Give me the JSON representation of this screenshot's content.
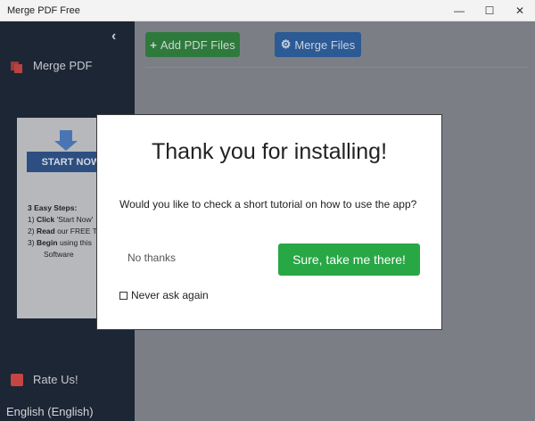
{
  "window": {
    "title": "Merge PDF Free",
    "minimize_glyph": "—",
    "maximize_glyph": "☐",
    "close_glyph": "✕"
  },
  "sidebar": {
    "collapse_glyph": "‹",
    "items": [
      {
        "label": "Merge PDF",
        "icon": "pdf-icon"
      },
      {
        "label": "Rate Us!",
        "icon": "rate-icon"
      }
    ],
    "language": "English (English)"
  },
  "ad": {
    "start_label": "START NOW",
    "steps_title": "3 Easy Steps:",
    "step1_num": "1)",
    "step1_bold": "Click",
    "step1_text": "'Start Now'",
    "step2_num": "2)",
    "step2_bold": "Read",
    "step2_text": "our FREE Tu",
    "step3_num": "3)",
    "step3_bold": "Begin",
    "step3_text": "using this",
    "step3_line2": "Software"
  },
  "toolbar": {
    "add_label": "Add PDF Files",
    "add_glyph": "+",
    "merge_label": "Merge Files",
    "merge_glyph": "⚙"
  },
  "modal": {
    "title": "Thank you for installing!",
    "question": "Would you like to check a short tutorial on how to use the app?",
    "decline_label": "No thanks",
    "accept_label": "Sure, take me there!",
    "never_label": "Never ask again",
    "never_checked": false
  },
  "colors": {
    "accept": "#28a745",
    "sidebar": "#1d2634",
    "overlay_bg": "#7b7f85"
  }
}
